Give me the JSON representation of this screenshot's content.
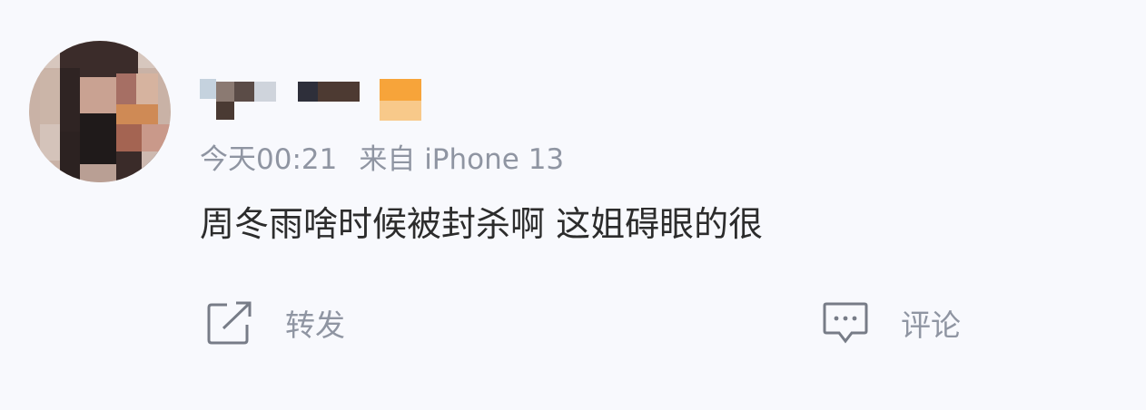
{
  "post": {
    "meta": {
      "time": "今天00:21",
      "source": "来自 iPhone 13"
    },
    "content": "周冬雨啥时候被封杀啊 这姐碍眼的很"
  },
  "actions": {
    "repost": {
      "label": "转发",
      "icon": "share-icon"
    },
    "comment": {
      "label": "评论",
      "icon": "comment-icon"
    }
  },
  "colors": {
    "background": "#f8f9fd",
    "text": "#2c2c2c",
    "meta": "#8f95a2",
    "vip_badge": "#f7a43a"
  }
}
